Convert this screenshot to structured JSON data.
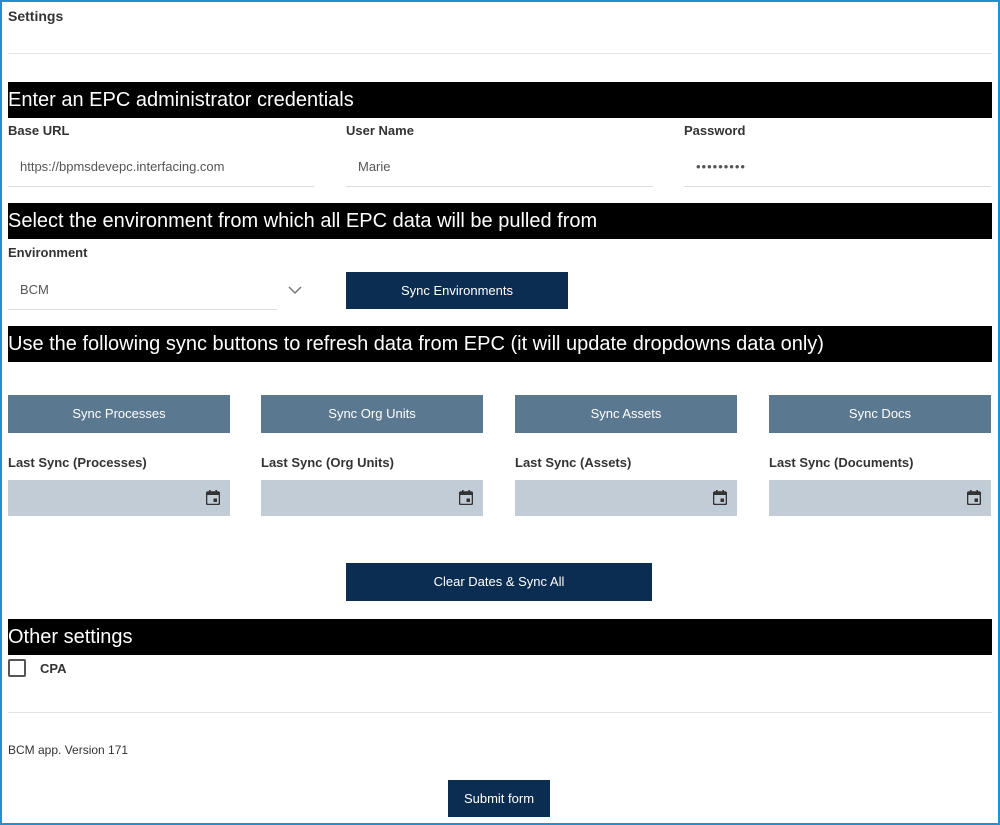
{
  "page": {
    "title": "Settings"
  },
  "credentials": {
    "banner": "Enter an EPC administrator credentials",
    "base_url_label": "Base URL",
    "base_url_value": "https://bpmsdevepc.interfacing.com",
    "user_name_label": "User Name",
    "user_name_value": "Marie",
    "password_label": "Password",
    "password_value": "•••••••••"
  },
  "environment": {
    "banner": "Select the environment from which all EPC data will be pulled from",
    "label": "Environment",
    "selected": "BCM",
    "sync_button": "Sync Environments"
  },
  "sync": {
    "banner": "Use the following sync buttons to refresh data from EPC (it will update dropdowns data only)",
    "buttons": [
      {
        "label": "Sync Processes",
        "last_label": "Last Sync (Processes)"
      },
      {
        "label": "Sync Org Units",
        "last_label": "Last Sync (Org Units)"
      },
      {
        "label": "Sync Assets",
        "last_label": "Last Sync (Assets)"
      },
      {
        "label": "Sync Docs",
        "last_label": "Last Sync (Documents)"
      }
    ],
    "clear_all_button": "Clear Dates & Sync All"
  },
  "other": {
    "banner": "Other settings",
    "cpa_label": "CPA"
  },
  "footer": {
    "version": "BCM app. Version 171",
    "submit_button": "Submit form"
  },
  "colors": {
    "banner_bg": "#000000",
    "primary_button": "#0c2d52",
    "secondary_button": "#5b7891",
    "date_field_bg": "#c2ccd6",
    "frame_border": "#1f8fd6"
  }
}
